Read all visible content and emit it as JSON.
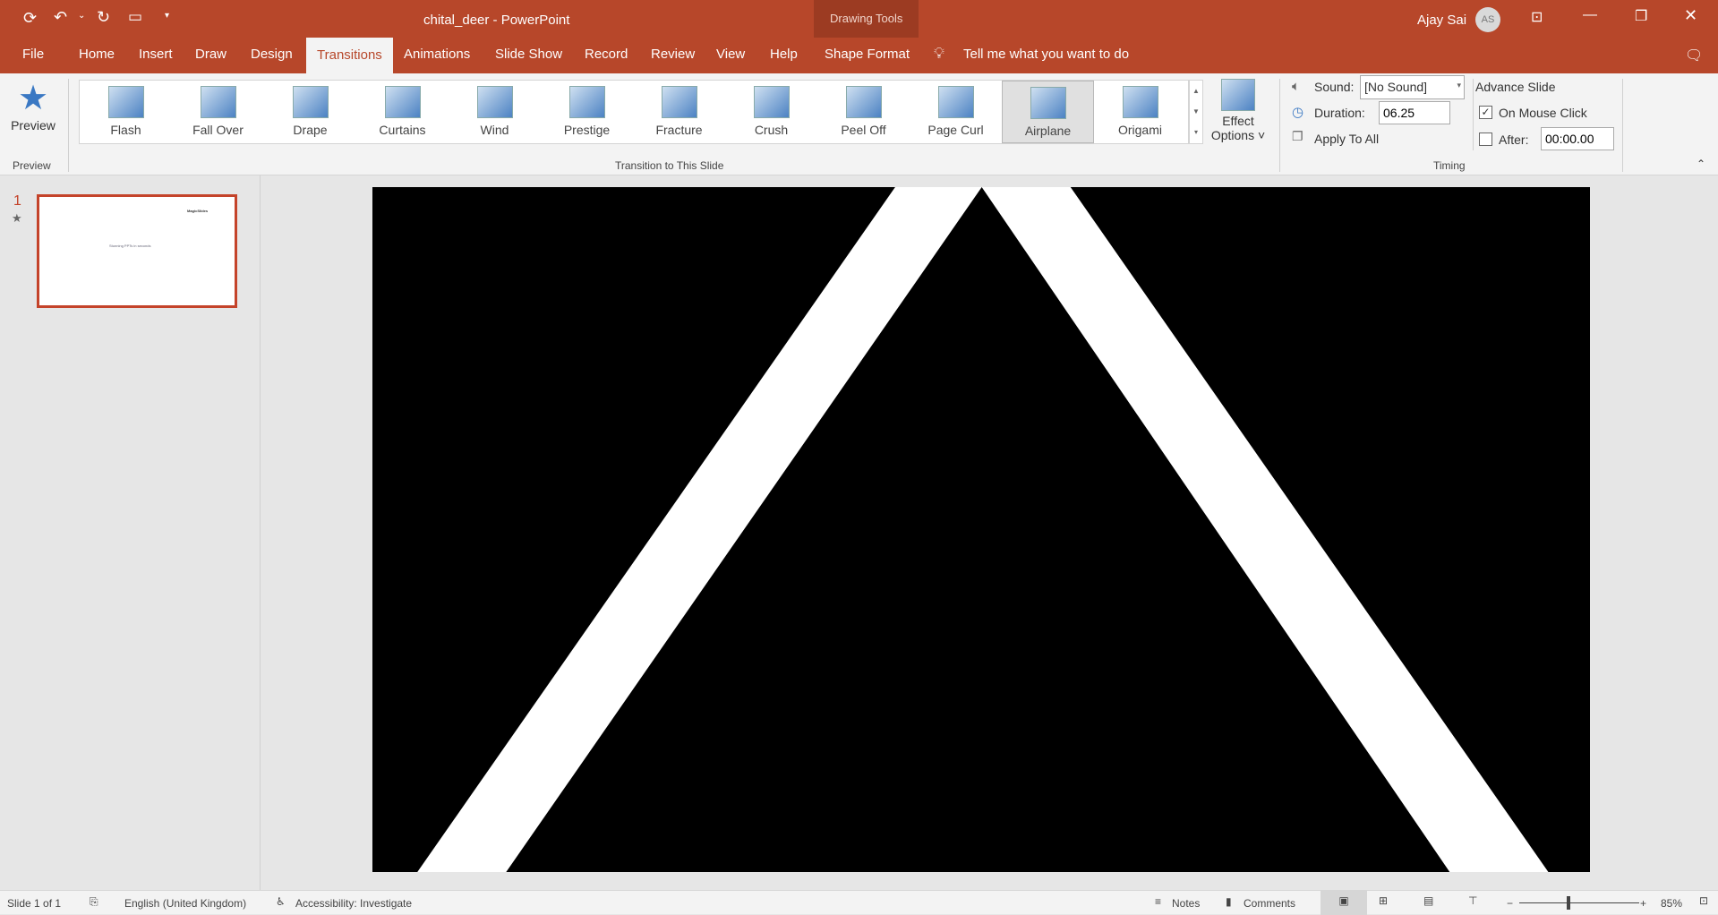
{
  "title": "chital_deer  -  PowerPoint",
  "contextual": "Drawing Tools",
  "user": {
    "name": "Ajay Sai",
    "initials": "AS"
  },
  "tabs": [
    "File",
    "Home",
    "Insert",
    "Draw",
    "Design",
    "Transitions",
    "Animations",
    "Slide Show",
    "Record",
    "Review",
    "View",
    "Help",
    "Shape Format"
  ],
  "tell_me": "Tell me what you want to do",
  "preview": {
    "label": "Preview",
    "group": "Preview"
  },
  "gallery": {
    "items": [
      "Flash",
      "Fall Over",
      "Drape",
      "Curtains",
      "Wind",
      "Prestige",
      "Fracture",
      "Crush",
      "Peel Off",
      "Page Curl",
      "Airplane",
      "Origami"
    ],
    "selected": "Airplane",
    "group": "Transition to This Slide"
  },
  "effect_options": {
    "line1": "Effect",
    "line2": "Options"
  },
  "timing": {
    "sound_label": "Sound:",
    "sound_value": "[No Sound]",
    "duration_label": "Duration:",
    "duration_value": "06.25",
    "apply_all": "Apply To All",
    "advance": "Advance Slide",
    "on_click": "On Mouse Click",
    "after_label": "After:",
    "after_value": "00:00.00",
    "group": "Timing"
  },
  "thumbnail": {
    "number": "1",
    "text": "Stunning PPTs in seconds",
    "logo": "MagicSlides"
  },
  "status": {
    "slide": "Slide 1 of 1",
    "language": "English (United Kingdom)",
    "accessibility": "Accessibility: Investigate",
    "notes": "Notes",
    "comments": "Comments",
    "zoom": "85%"
  }
}
